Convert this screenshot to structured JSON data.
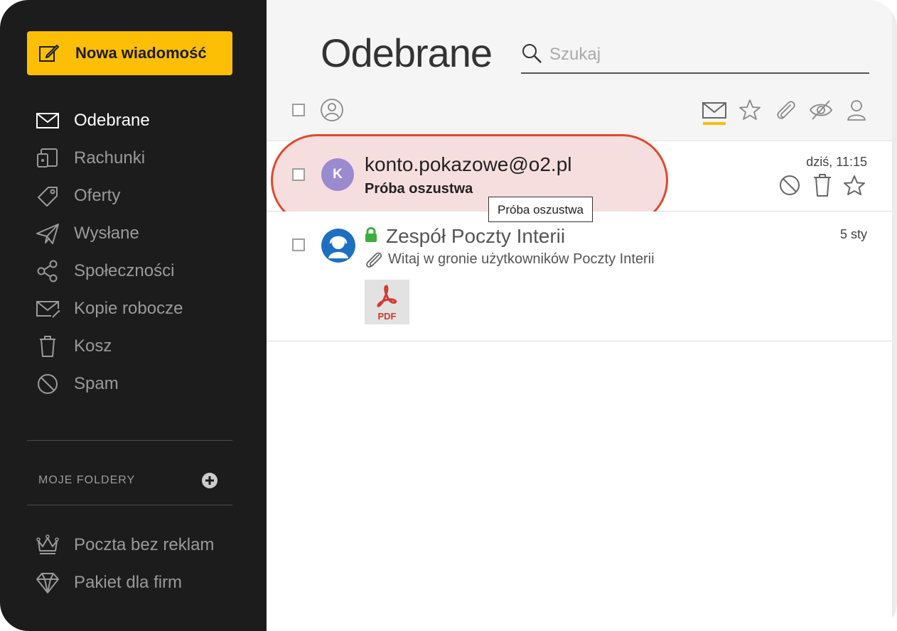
{
  "sidebar": {
    "new_message_label": "Nowa wiadomość",
    "nav": [
      {
        "label": "Odebrane",
        "icon": "envelope-icon",
        "active": true
      },
      {
        "label": "Rachunki",
        "icon": "bills-icon"
      },
      {
        "label": "Oferty",
        "icon": "tag-icon"
      },
      {
        "label": "Wysłane",
        "icon": "paper-plane-icon"
      },
      {
        "label": "Społeczności",
        "icon": "share-icon"
      },
      {
        "label": "Kopie robocze",
        "icon": "draft-envelope-icon"
      },
      {
        "label": "Kosz",
        "icon": "trash-icon"
      },
      {
        "label": "Spam",
        "icon": "ban-icon"
      }
    ],
    "folders_title": "MOJE FOLDERY",
    "promo": [
      {
        "label": "Poczta bez reklam",
        "icon": "crown-icon"
      },
      {
        "label": "Pakiet dla firm",
        "icon": "diamond-icon"
      }
    ]
  },
  "header": {
    "title": "Odebrane",
    "search_placeholder": "Szukaj"
  },
  "toolbar": {
    "filters": [
      "envelope-icon",
      "star-icon",
      "paperclip-icon",
      "eye-off-icon",
      "person-icon"
    ],
    "active_filter": "envelope-icon"
  },
  "messages": [
    {
      "avatar_letter": "K",
      "avatar_color": "#9a8ad0",
      "sender": "konto.pokazowe@o2.pl",
      "subject": "Próba oszustwa",
      "date": "dziś, 11:15",
      "tooltip": "Próba oszustwa",
      "highlighted": true
    },
    {
      "sender": "Zespół Poczty Interii",
      "subject": "Witaj w gronie użytkowników Poczty Interii",
      "date": "5 sty",
      "attachment_label": "PDF",
      "verified_color": "#3dae3d"
    }
  ],
  "colors": {
    "accent": "#fcbf05",
    "highlight_border": "#e0492f",
    "highlight_fill": "#f7dede",
    "sidebar_bg": "#1c1c1c"
  }
}
